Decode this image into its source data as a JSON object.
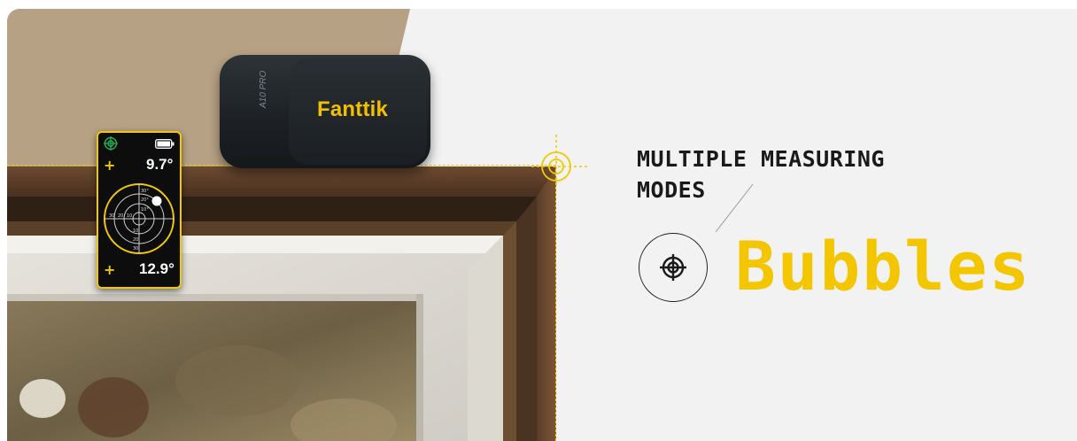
{
  "product": {
    "brand": "Fanttik",
    "model": "A10 PRO"
  },
  "phone_screen": {
    "angle_top": "9.7°",
    "angle_bottom": "12.9°",
    "scale_labels": [
      "30°",
      "20°",
      "10°",
      "10",
      "20",
      "30",
      "10",
      "20",
      "30"
    ]
  },
  "feature": {
    "headline_line1": "MULTIPLE MEASURING",
    "headline_line2": "MODES",
    "mode_name": "Bubbles",
    "mode_icon": "target-crosshair-icon"
  },
  "colors": {
    "accent_yellow": "#f3c600",
    "headline_text": "#1a1a1a",
    "background": "#f2f2f2"
  }
}
